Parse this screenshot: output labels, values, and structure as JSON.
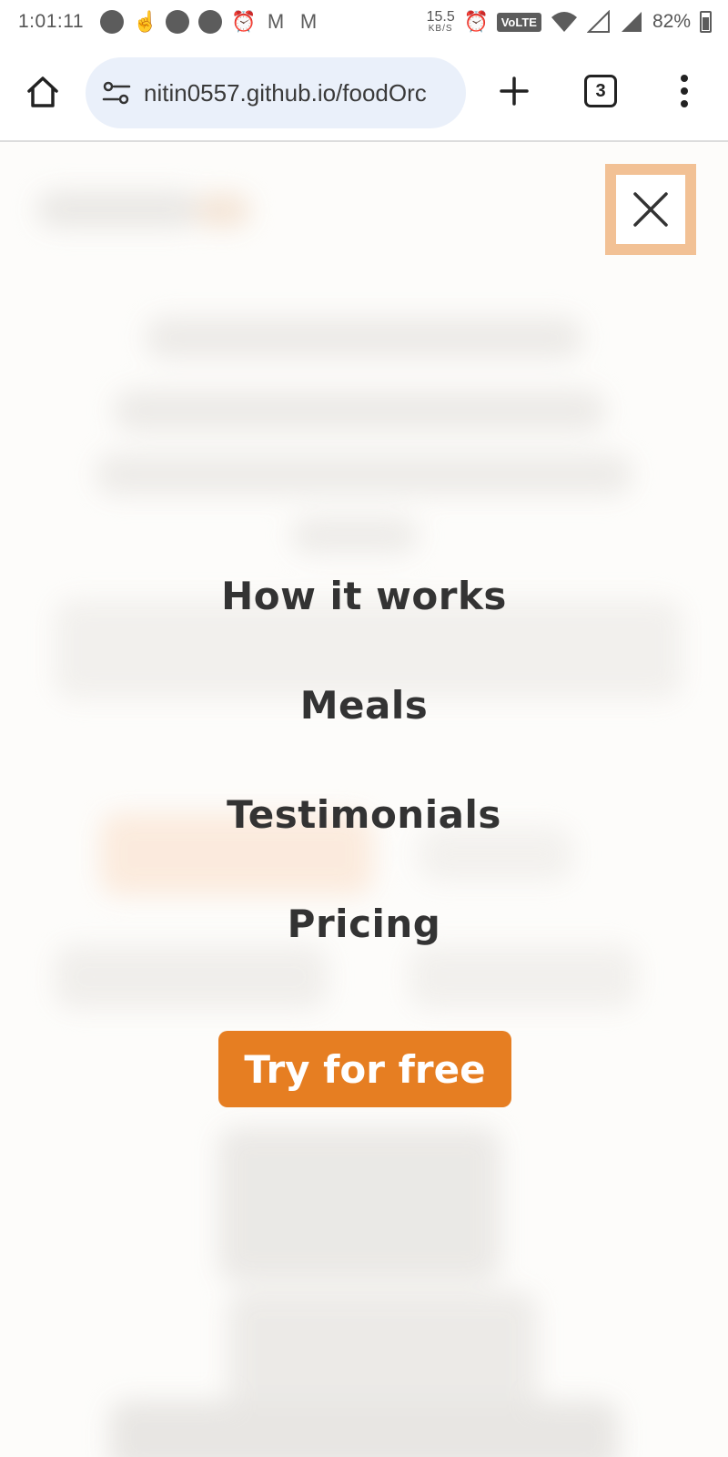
{
  "status_bar": {
    "time": "1:01:11",
    "net_speed_value": "15.5",
    "net_speed_unit": "KB/S",
    "volte_label": "VoLTE",
    "battery_percent": "82%"
  },
  "browser": {
    "url": "nitin0557.github.io/foodOrc",
    "tab_count": "3"
  },
  "nav_menu": {
    "items": [
      {
        "label": "How it works"
      },
      {
        "label": "Meals"
      },
      {
        "label": "Testimonials"
      },
      {
        "label": "Pricing"
      }
    ],
    "cta_label": "Try for free"
  },
  "colors": {
    "accent": "#e67e22",
    "close_highlight": "#f2c195",
    "text": "#333333",
    "page_background": "#fdfcfa"
  }
}
